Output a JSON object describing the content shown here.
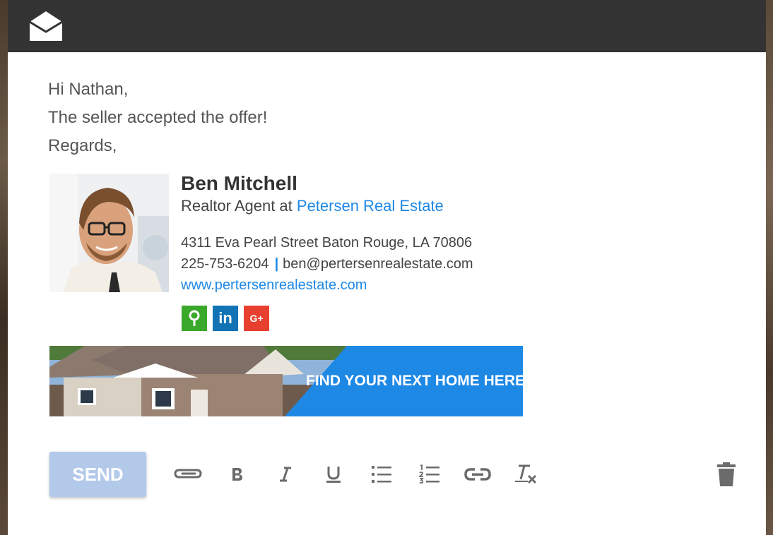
{
  "email": {
    "greeting": "Hi Nathan,",
    "message": "The seller accepted the offer!",
    "closing": "Regards,"
  },
  "signature": {
    "name": "Ben Mitchell",
    "role_prefix": "Realtor Agent at ",
    "company": "Petersen Real Estate",
    "address": "4311 Eva Pearl Street Baton Rouge, LA 70806",
    "phone": "225-753-6204",
    "separator": "|",
    "email": "ben@pertersenrealestate.com",
    "website": "www.pertersenrealestate.com",
    "social": [
      {
        "icon": "map-pin-icon",
        "color": "#3aa82a"
      },
      {
        "icon": "linkedin-icon",
        "label": "in",
        "color": "#1273b5"
      },
      {
        "icon": "google-plus-icon",
        "label": "G+",
        "color": "#e8402f"
      }
    ]
  },
  "banner": {
    "text": "FIND YOUR NEXT HOME HERE",
    "color": "#1e88e5"
  },
  "toolbar": {
    "send_label": "SEND",
    "tools": [
      "attach-icon",
      "bold-icon",
      "italic-icon",
      "underline-icon",
      "bulleted-list-icon",
      "numbered-list-icon",
      "link-icon",
      "clear-formatting-icon"
    ],
    "delete": "trash-icon"
  },
  "colors": {
    "titlebar": "#333333",
    "accent": "#1e88e5",
    "send_button": "#b3c9ea"
  }
}
